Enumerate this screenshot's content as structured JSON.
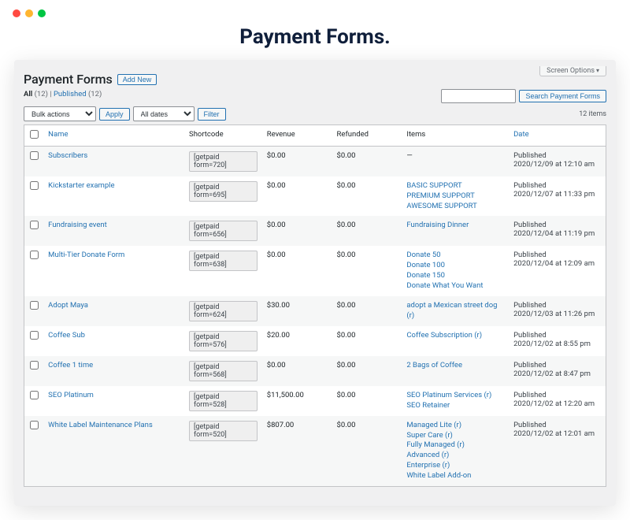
{
  "main_title": "Payment Forms.",
  "screen_options": "Screen Options",
  "page_title": "Payment Forms",
  "add_new": "Add New",
  "subsub": {
    "all_label": "All",
    "all_count": "(12)",
    "sep": " | ",
    "published_label": "Published",
    "published_count": "(12)"
  },
  "bulk": {
    "placeholder": "Bulk actions",
    "apply": "Apply"
  },
  "dates": {
    "placeholder": "All dates",
    "filter": "Filter"
  },
  "search": {
    "button": "Search Payment Forms"
  },
  "count_text": "12 items",
  "columns": {
    "name": "Name",
    "shortcode": "Shortcode",
    "revenue": "Revenue",
    "refunded": "Refunded",
    "items": "Items",
    "date": "Date"
  },
  "rows": [
    {
      "name": "Subscribers",
      "shortcode": "[getpaid form=720]",
      "revenue": "$0.00",
      "refunded": "$0.00",
      "items": [
        "—"
      ],
      "items_plain": true,
      "date_status": "Published",
      "date_ts": "2020/12/09 at 12:10 am"
    },
    {
      "name": "Kickstarter example",
      "shortcode": "[getpaid form=695]",
      "revenue": "$0.00",
      "refunded": "$0.00",
      "items": [
        "BASIC SUPPORT",
        "PREMIUM SUPPORT",
        "AWESOME SUPPORT"
      ],
      "date_status": "Published",
      "date_ts": "2020/12/07 at 11:33 pm"
    },
    {
      "name": "Fundraising event",
      "shortcode": "[getpaid form=656]",
      "revenue": "$0.00",
      "refunded": "$0.00",
      "items": [
        "Fundraising Dinner"
      ],
      "date_status": "Published",
      "date_ts": "2020/12/04 at 11:19 pm"
    },
    {
      "name": "Multi-Tier Donate Form",
      "shortcode": "[getpaid form=638]",
      "revenue": "$0.00",
      "refunded": "$0.00",
      "items": [
        "Donate 50",
        "Donate 100",
        "Donate 150",
        "Donate What You Want"
      ],
      "date_status": "Published",
      "date_ts": "2020/12/04 at 12:09 am"
    },
    {
      "name": "Adopt Maya",
      "shortcode": "[getpaid form=624]",
      "revenue": "$30.00",
      "refunded": "$0.00",
      "items": [
        "adopt a Mexican street dog (r)"
      ],
      "date_status": "Published",
      "date_ts": "2020/12/03 at 11:26 pm"
    },
    {
      "name": "Coffee Sub",
      "shortcode": "[getpaid form=576]",
      "revenue": "$20.00",
      "refunded": "$0.00",
      "items": [
        "Coffee Subscription (r)"
      ],
      "date_status": "Published",
      "date_ts": "2020/12/02 at 8:55 pm"
    },
    {
      "name": "Coffee 1 time",
      "shortcode": "[getpaid form=568]",
      "revenue": "$0.00",
      "refunded": "$0.00",
      "items": [
        "2 Bags of Coffee"
      ],
      "date_status": "Published",
      "date_ts": "2020/12/02 at 8:47 pm"
    },
    {
      "name": "SEO Platinum",
      "shortcode": "[getpaid form=528]",
      "revenue": "$11,500.00",
      "refunded": "$0.00",
      "items": [
        "SEO Platinum Services (r)",
        "SEO Retainer"
      ],
      "date_status": "Published",
      "date_ts": "2020/12/02 at 12:20 am"
    },
    {
      "name": "White Label Maintenance Plans",
      "shortcode": "[getpaid form=520]",
      "revenue": "$807.00",
      "refunded": "$0.00",
      "items": [
        "Managed Lite (r)",
        "Super Care (r)",
        "Fully Managed (r)",
        "Advanced (r)",
        "Enterprise (r)",
        "White Label Add-on"
      ],
      "date_status": "Published",
      "date_ts": "2020/12/02 at 12:01 am"
    }
  ]
}
